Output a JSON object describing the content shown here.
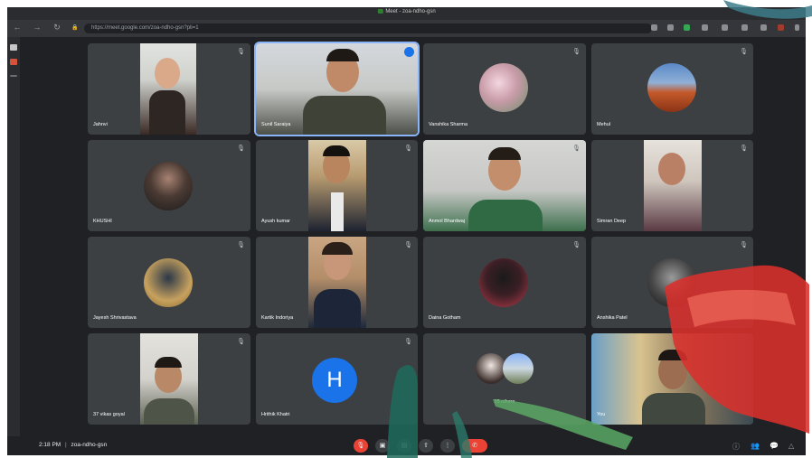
{
  "window": {
    "tab_title": "Meet - zoa-ndho-gsn"
  },
  "address_bar": {
    "url": "https://meet.google.com/zoa-ndho-gsn?pli=1",
    "back": "←",
    "forward": "→",
    "reload": "↻",
    "lock": "🔒"
  },
  "participants": [
    {
      "name": "Jahnvi",
      "mic": "🎙"
    },
    {
      "name": "Sunil Saraiya",
      "mic": "🎙"
    },
    {
      "name": "Vanshika Sharma",
      "mic": "🎙"
    },
    {
      "name": "Mehul",
      "mic": "🎙"
    },
    {
      "name": "KHUSHI",
      "mic": "🎙"
    },
    {
      "name": "Ayush kumar",
      "mic": "🎙"
    },
    {
      "name": "Anmol Bhardwaj",
      "mic": "🎙"
    },
    {
      "name": "Simran Deep",
      "mic": "🎙"
    },
    {
      "name": "Jayesh Shrivastava",
      "mic": "🎙"
    },
    {
      "name": "Kartik Indoriya",
      "mic": "🎙"
    },
    {
      "name": "Daina Gotham",
      "mic": "🎙"
    },
    {
      "name": "Anshika Patel",
      "mic": "🎙"
    },
    {
      "name": "37 vikas goyal",
      "mic": "🎙"
    },
    {
      "name": "Hrithik Khatri",
      "mic": "🎙",
      "initial": "H"
    },
    {
      "name": "35 others",
      "mic": ""
    },
    {
      "name": "You",
      "mic": ""
    }
  ],
  "bottom_bar": {
    "time": "2:18 PM",
    "separator": "|",
    "meeting_code": "zoa-ndho-gsn",
    "mic_glyph": "🎙",
    "cam_glyph": "▣",
    "cc_glyph": "▤",
    "present_glyph": "⇧",
    "more_glyph": "⋮",
    "leave_glyph": "✆",
    "info_glyph": "ⓘ",
    "people_glyph": "👥",
    "chat_glyph": "💬",
    "activities_glyph": "△"
  },
  "colors": {
    "active_tile_border": "#8ab4f8",
    "leave_red": "#ea4335",
    "avatar_blue": "#1a73e8",
    "tile_bg": "#3c4043",
    "background": "#202124"
  }
}
